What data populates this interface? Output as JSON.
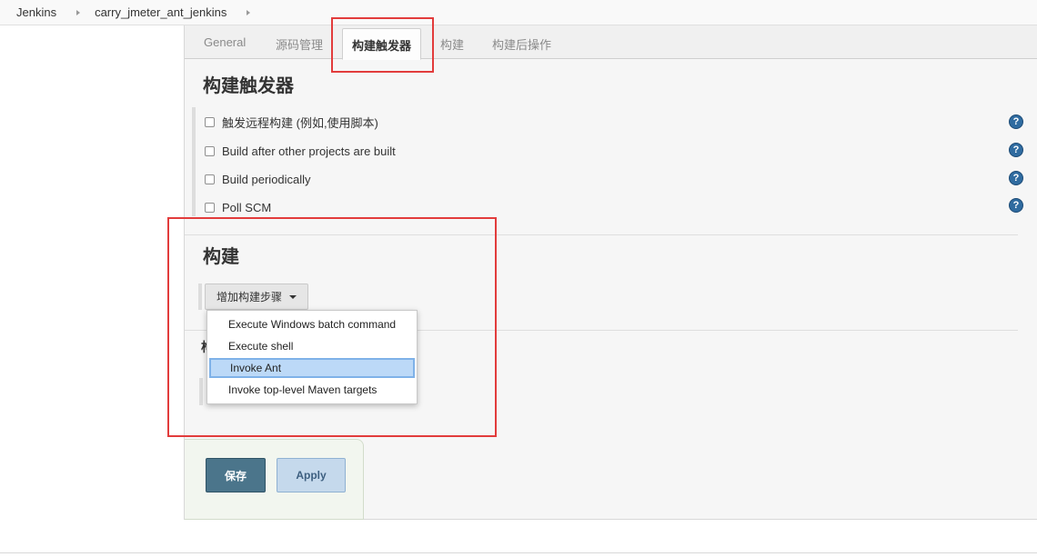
{
  "breadcrumb": {
    "items": [
      "Jenkins",
      "carry_jmeter_ant_jenkins"
    ]
  },
  "tabs": [
    "General",
    "源码管理",
    "构建触发器",
    "构建",
    "构建后操作"
  ],
  "active_tab": "构建触发器",
  "triggers": {
    "title": "构建触发器",
    "options": [
      {
        "label": "触发远程构建 (例如,使用脚本)",
        "checked": false
      },
      {
        "label": "Build after other projects are built",
        "checked": false
      },
      {
        "label": "Build periodically",
        "checked": false
      },
      {
        "label": "Poll SCM",
        "checked": false
      }
    ],
    "help_icon": "question-circle-icon"
  },
  "build": {
    "title": "构建",
    "add_step_label": "增加构建步骤",
    "dropdown_items": [
      "Execute Windows batch command",
      "Execute shell",
      "Invoke Ant",
      "Invoke top-level Maven targets"
    ],
    "highlighted_item": "Invoke Ant"
  },
  "footer": {
    "save_label": "保存",
    "apply_label": "Apply"
  },
  "colors": {
    "annotation": "#e23c3c",
    "save_button": "#4b758b",
    "apply_button": "#c5d9ec",
    "help_icon": "#2f6ba0",
    "highlight": "#bcd9f7"
  }
}
